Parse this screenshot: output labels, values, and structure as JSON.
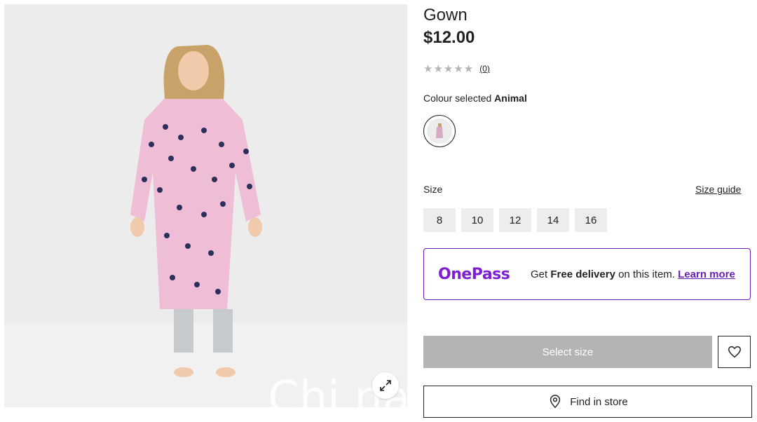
{
  "product": {
    "title": "Gown",
    "price": "$12.00",
    "rating": {
      "stars": "★★★★★",
      "review_count": "(0)"
    },
    "colour": {
      "prefix": "Colour selected",
      "value": "Animal"
    }
  },
  "size": {
    "label": "Size",
    "guide_link": "Size guide",
    "options": [
      "8",
      "10",
      "12",
      "14",
      "16"
    ]
  },
  "onepass": {
    "logo": "OnePass",
    "text_prefix": "Get",
    "text_bold": "Free delivery",
    "text_suffix": "on this item.",
    "link": "Learn more",
    "brand_color": "#6b1fb3"
  },
  "actions": {
    "select_size": "Select size",
    "find_in_store": "Find in store"
  },
  "icons": {
    "expand": "expand-icon",
    "heart": "heart-icon",
    "location": "location-pin-icon"
  },
  "watermark": "Chi na"
}
